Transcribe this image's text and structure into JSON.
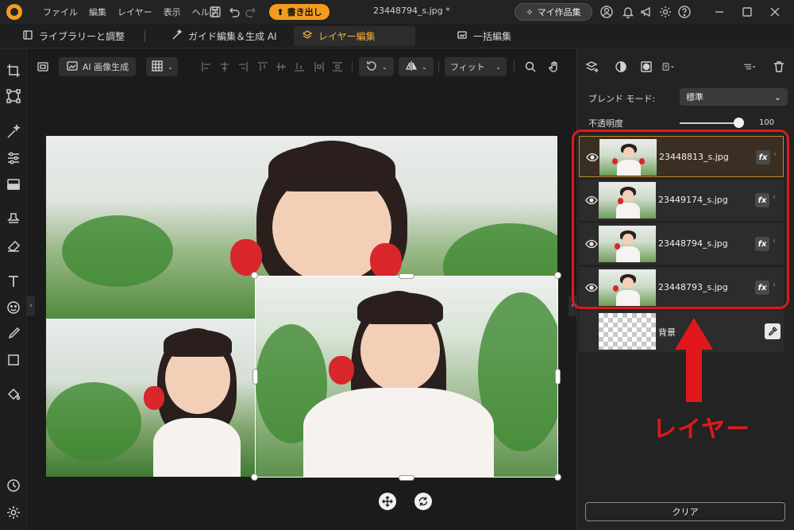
{
  "window": {
    "menu": [
      "ファイル",
      "編集",
      "レイヤー",
      "表示",
      "ヘルプ"
    ],
    "export_label": "書き出し",
    "doc_title": "23448794_s.jpg *",
    "mywork_label": "マイ作品集"
  },
  "tabs": [
    {
      "label": "ライブラリーと調整",
      "icon": "library-icon"
    },
    {
      "label": "ガイド編集＆生成 AI",
      "icon": "magic-wand-icon"
    },
    {
      "label": "レイヤー編集",
      "icon": "layers-icon",
      "active": true
    },
    {
      "label": "一括編集",
      "icon": "batch-icon"
    }
  ],
  "canvas_toolbar": {
    "ai_generate_label": "AI 画像生成",
    "zoom_label": "フィット"
  },
  "layer_panel": {
    "blend_mode_label": "ブレンド モード:",
    "blend_mode_value": "標準",
    "opacity_label": "不透明度",
    "opacity_value": "100",
    "opacity_fraction": 1.0,
    "layers": [
      {
        "name": "23448813_s.jpg",
        "visible": true,
        "selected": true,
        "fx": "fx"
      },
      {
        "name": "23449174_s.jpg",
        "visible": true,
        "selected": false,
        "fx": "fx"
      },
      {
        "name": "23448794_s.jpg",
        "visible": true,
        "selected": false,
        "fx": "fx"
      },
      {
        "name": "23448793_s.jpg",
        "visible": true,
        "selected": false,
        "fx": "fx"
      }
    ],
    "background_layer_name": "背景",
    "clear_label": "クリア"
  },
  "annotation": {
    "text": "レイヤー",
    "color": "#e0181c"
  },
  "colors": {
    "accent": "#f29c1f",
    "selection_border": "#c98a2a"
  }
}
